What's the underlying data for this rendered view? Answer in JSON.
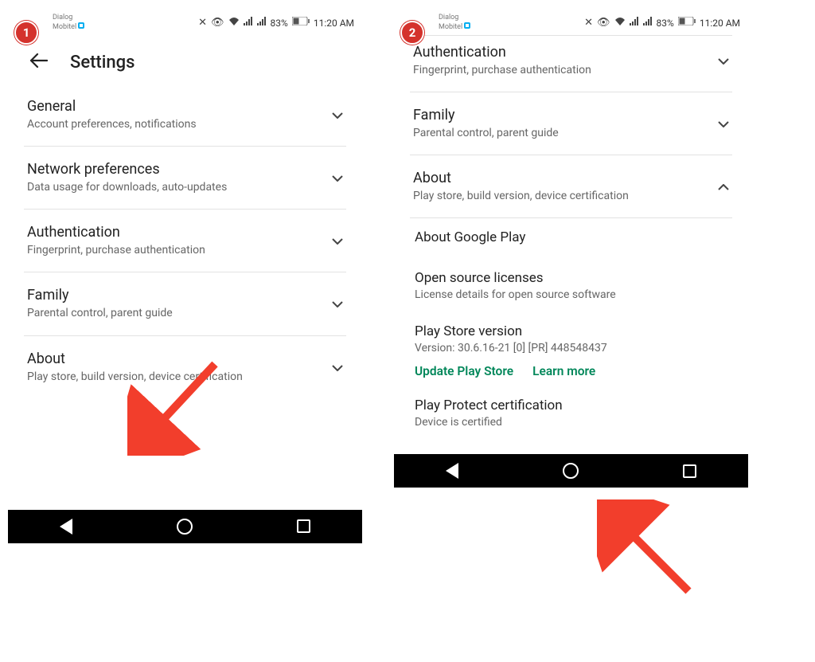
{
  "status": {
    "carrier1": "Dialog",
    "carrier2": "Mobitel",
    "battery": "83%",
    "time": "11:20 AM"
  },
  "screen1": {
    "title": "Settings",
    "rows": [
      {
        "title": "General",
        "subtitle": "Account preferences, notifications"
      },
      {
        "title": "Network preferences",
        "subtitle": "Data usage for downloads, auto-updates"
      },
      {
        "title": "Authentication",
        "subtitle": "Fingerprint, purchase authentication"
      },
      {
        "title": "Family",
        "subtitle": "Parental control, parent guide"
      },
      {
        "title": "About",
        "subtitle": "Play store, build version, device certification"
      }
    ]
  },
  "screen2": {
    "rows": [
      {
        "title": "Authentication",
        "subtitle": "Fingerprint, purchase authentication"
      },
      {
        "title": "Family",
        "subtitle": "Parental control, parent guide"
      },
      {
        "title": "About",
        "subtitle": "Play store, build version, device certification"
      }
    ],
    "sub": [
      {
        "title": "About Google Play",
        "subtitle": ""
      },
      {
        "title": "Open source licenses",
        "subtitle": "License details for open source software"
      },
      {
        "title": "Play Store version",
        "subtitle": "Version: 30.6.16-21 [0] [PR] 448548437"
      }
    ],
    "actions": {
      "update": "Update Play Store",
      "learn": "Learn more"
    },
    "protect": {
      "title": "Play Protect certification",
      "subtitle": "Device is certified"
    }
  },
  "steps": {
    "s1": "1",
    "s2": "2"
  }
}
